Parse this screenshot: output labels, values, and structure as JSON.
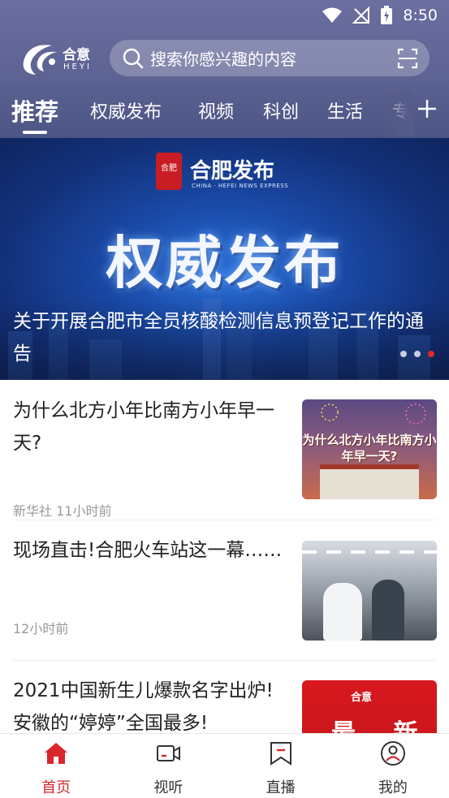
{
  "status": {
    "time": "8:50"
  },
  "logo": {
    "text": "合意",
    "sub": "HEYI"
  },
  "search": {
    "placeholder": "搜索你感兴趣的内容"
  },
  "tabs": [
    "推荐",
    "权威发布",
    "视频",
    "科创",
    "生活",
    "专"
  ],
  "banner": {
    "brand": "合肥发布",
    "brand_sub": "CHINA · HEFEI NEWS EXPRESS",
    "seal": "合肥",
    "headline_image_text": "权威发布",
    "caption": "关于开展合肥市全员核酸检测信息预登记工作的通告",
    "slides": 3,
    "active_slide": 3
  },
  "feed": [
    {
      "title": "为什么北方小年比南方小年早一天?",
      "meta": "新华社  11小时前",
      "thumb_text": "为什么北方小年比南方小年早一天?"
    },
    {
      "title": "现场直击!合肥火车站这一幕……",
      "meta": "12小时前"
    },
    {
      "title": "2021中国新生儿爆款名字出炉!安徽的“婷婷”全国最多!",
      "thumb_logo": "合意",
      "thumb_text": "最 新"
    }
  ],
  "bottom_nav": [
    {
      "label": "首页",
      "icon": "home-icon",
      "active": true
    },
    {
      "label": "视听",
      "icon": "video-icon",
      "active": false
    },
    {
      "label": "直播",
      "icon": "live-icon",
      "active": false
    },
    {
      "label": "我的",
      "icon": "profile-icon",
      "active": false
    }
  ],
  "colors": {
    "accent": "#d8262c",
    "header": "#5d6393"
  }
}
